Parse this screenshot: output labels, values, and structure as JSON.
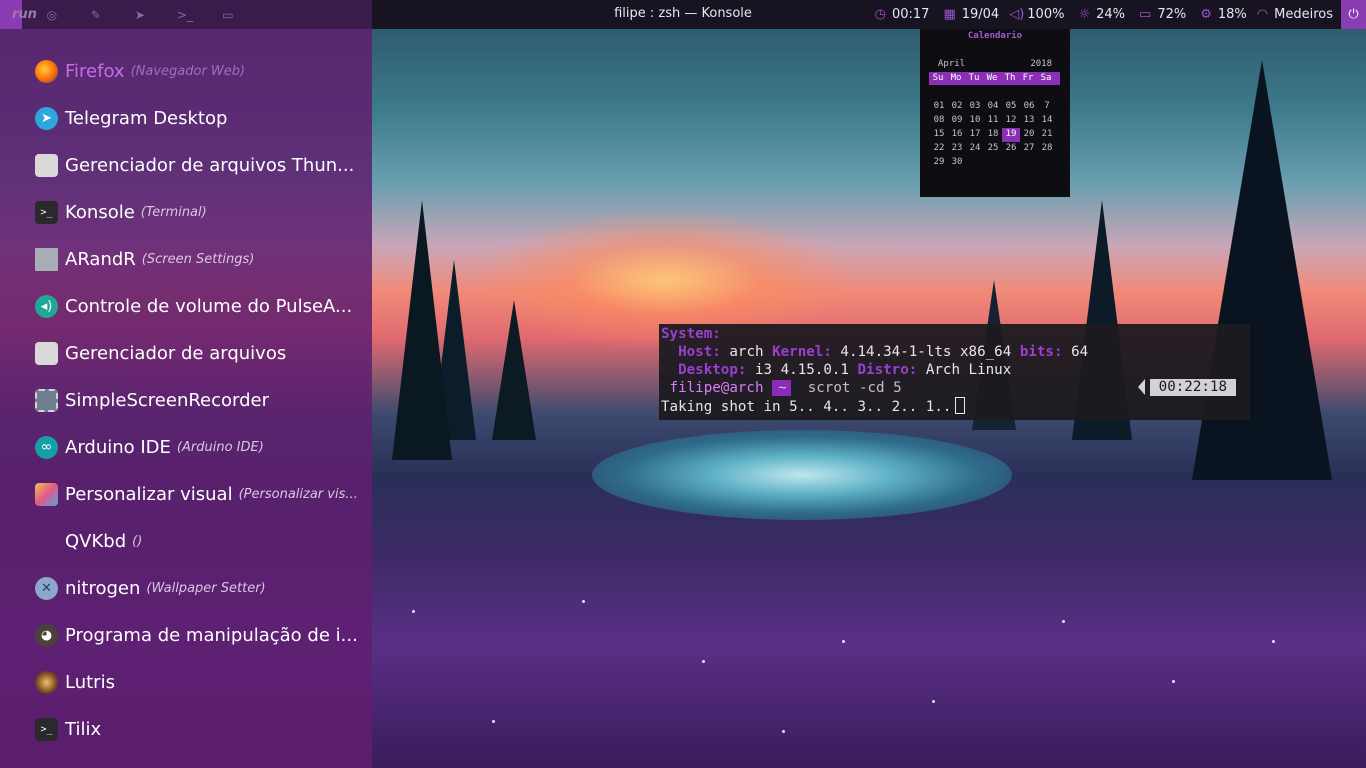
{
  "topbar": {
    "launcher_label": "run",
    "window_title": "filipe : zsh — Konsole",
    "status": {
      "time": "00:17",
      "date": "19/04",
      "volume": "100%",
      "brightness": "24%",
      "battery": "72%",
      "cpu": "18%",
      "wifi": "Medeiros"
    },
    "icons": [
      "firefox-icon",
      "edit-icon",
      "telegram-icon",
      "terminal-icon",
      "display-icon",
      "clock-icon",
      "calendar-icon",
      "volume-icon",
      "brightness-icon",
      "battery-icon",
      "cpu-icon",
      "wifi-icon",
      "power-icon"
    ]
  },
  "menu": {
    "items": [
      {
        "name": "Firefox",
        "sub": "(Navegador Web)",
        "selected": true
      },
      {
        "name": "Telegram Desktop",
        "sub": ""
      },
      {
        "name": "Gerenciador de arquivos Thun...",
        "sub": ""
      },
      {
        "name": "Konsole",
        "sub": "(Terminal)"
      },
      {
        "name": "ARandR",
        "sub": "(Screen Settings)"
      },
      {
        "name": "Controle de volume do PulseA...",
        "sub": ""
      },
      {
        "name": "Gerenciador de arquivos",
        "sub": ""
      },
      {
        "name": "SimpleScreenRecorder",
        "sub": ""
      },
      {
        "name": "Arduino IDE",
        "sub": "(Arduino IDE)"
      },
      {
        "name": "Personalizar visual",
        "sub": "(Personalizar vis..."
      },
      {
        "name": "QVKbd",
        "sub": "()"
      },
      {
        "name": "nitrogen",
        "sub": "(Wallpaper Setter)"
      },
      {
        "name": "Programa de manipulação de i...",
        "sub": ""
      },
      {
        "name": "Lutris",
        "sub": ""
      },
      {
        "name": "Tilix",
        "sub": ""
      }
    ]
  },
  "calendar": {
    "title": "Calendario",
    "month": "April",
    "year": "2018",
    "weekdays": [
      "Su",
      "Mo",
      "Tu",
      "We",
      "Th",
      "Fr",
      "Sa"
    ],
    "weeks": [
      [
        "01",
        "02",
        "03",
        "04",
        "05",
        "06",
        "7"
      ],
      [
        "08",
        "09",
        "10",
        "11",
        "12",
        "13",
        "14"
      ],
      [
        "15",
        "16",
        "17",
        "18",
        "19",
        "20",
        "21"
      ],
      [
        "22",
        "23",
        "24",
        "25",
        "26",
        "27",
        "28"
      ],
      [
        "29",
        "30",
        "",
        "",
        "",
        "",
        ""
      ]
    ],
    "today": "19"
  },
  "terminal": {
    "system_label": "System:",
    "host_label": "Host:",
    "host_value": "arch",
    "kernel_label": "Kernel:",
    "kernel_value": "4.14.34-1-lts x86_64",
    "bits_label": "bits:",
    "bits_value": "64",
    "desktop_label": "Desktop:",
    "desktop_value": "i3 4.15.0.1",
    "distro_label": "Distro:",
    "distro_value": "Arch Linux",
    "prompt_user": "filipe@arch",
    "prompt_dir": "~",
    "command": "scrot -cd 5",
    "output": "Taking shot in 5.. 4.. 3.. 2.. 1..",
    "clock": "00:22:18"
  },
  "colors": {
    "accent": "#8b2fb6",
    "menu_bg": "#5f1e70",
    "topbar_bg": "#171320",
    "selected_text": "#c46fe8"
  }
}
